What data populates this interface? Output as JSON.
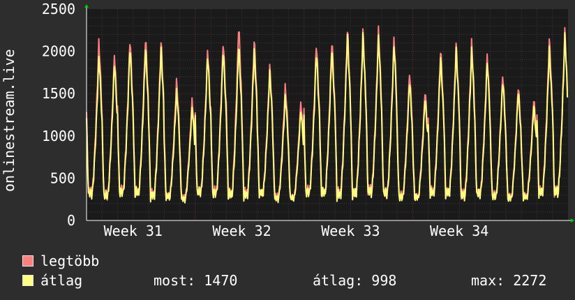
{
  "chart_data": {
    "type": "line",
    "ylabel": "onlinestream.live",
    "ylim": [
      0,
      2500
    ],
    "y_ticks": [
      0,
      500,
      1000,
      1500,
      2000,
      2500
    ],
    "x_ticks": [
      {
        "label": "Week 31",
        "day": 3
      },
      {
        "label": "Week 32",
        "day": 10
      },
      {
        "label": "Week 33",
        "day": 17
      },
      {
        "label": "Week 34",
        "day": 24
      }
    ],
    "x_range_days": [
      0,
      31
    ],
    "grid": true,
    "legend_placement": "bottom-left",
    "series": [
      {
        "name": "legtöbb",
        "color": "#ff7f7f",
        "daily_peaks": [
          2150,
          2000,
          2180,
          2200,
          2150,
          1680,
          1450,
          2050,
          2150,
          2340,
          2170,
          1850,
          1620,
          1420,
          2120,
          2170,
          2300,
          2280,
          2300,
          2190,
          1780,
          1560,
          2050,
          2120,
          2150,
          1980,
          1750,
          1620,
          1460,
          2180,
          2280
        ],
        "daily_troughs": [
          220,
          190,
          230,
          220,
          190,
          200,
          190,
          230,
          220,
          190,
          200,
          230,
          190,
          200,
          230,
          220,
          190,
          200,
          230,
          210,
          190,
          200,
          230,
          220,
          190,
          220,
          200,
          190,
          210,
          230,
          220
        ]
      },
      {
        "name": "átlag",
        "color": "#ffff80",
        "daily_peaks": [
          1970,
          1900,
          2080,
          2080,
          2060,
          1560,
          1350,
          1980,
          2050,
          2100,
          2050,
          1780,
          1500,
          1320,
          2020,
          2060,
          2230,
          2220,
          2200,
          2110,
          1680,
          1470,
          1960,
          2050,
          2050,
          1900,
          1680,
          1560,
          1380,
          2060,
          2220
        ],
        "daily_troughs": [
          210,
          180,
          220,
          210,
          180,
          190,
          180,
          220,
          210,
          180,
          190,
          220,
          180,
          190,
          220,
          210,
          180,
          190,
          220,
          200,
          180,
          190,
          220,
          210,
          180,
          210,
          190,
          180,
          200,
          220,
          210
        ]
      }
    ]
  },
  "legend": [
    {
      "label": "legtöbb",
      "color": "#ff7f7f"
    },
    {
      "label": "átlag",
      "color": "#ffff80"
    }
  ],
  "stats": {
    "now": "most: 1470",
    "avg": "átlag: 998",
    "max": "max: 2272"
  }
}
